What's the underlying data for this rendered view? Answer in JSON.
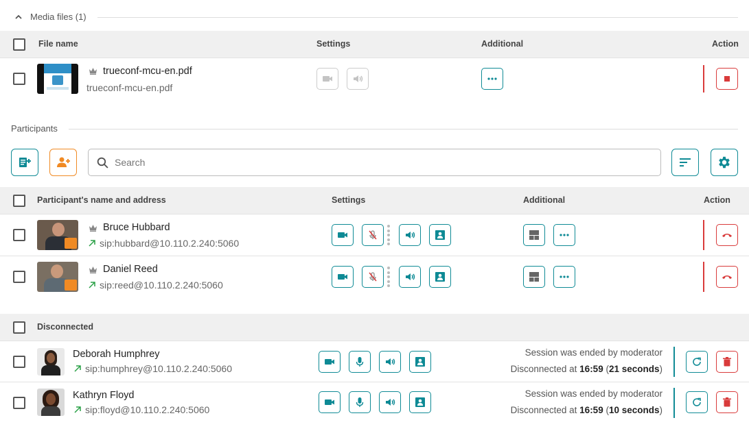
{
  "media": {
    "title": "Media files (1)",
    "headers": {
      "file_name": "File name",
      "settings": "Settings",
      "additional": "Additional",
      "action": "Action"
    },
    "file": {
      "title": "trueconf-mcu-en.pdf",
      "subtitle": "trueconf-mcu-en.pdf"
    }
  },
  "participants": {
    "title": "Participants",
    "search_placeholder": "Search",
    "headers": {
      "name": "Participant's name and address",
      "settings": "Settings",
      "additional": "Additional",
      "action": "Action"
    },
    "rows": [
      {
        "name": "Bruce Hubbard",
        "address": "sip:hubbard@10.110.2.240:5060"
      },
      {
        "name": "Daniel Reed",
        "address": "sip:reed@10.110.2.240:5060"
      }
    ]
  },
  "disconnected": {
    "title": "Disconnected",
    "rows": [
      {
        "name": "Deborah Humphrey",
        "address": "sip:humphrey@10.110.2.240:5060",
        "status": "Session was ended by moderator",
        "disc_prefix": "Disconnected at ",
        "time": "16:59",
        "paren_open": " (",
        "duration": "21 seconds",
        "paren_close": ")"
      },
      {
        "name": "Kathryn Floyd",
        "address": "sip:floyd@10.110.2.240:5060",
        "status": "Session was ended by moderator",
        "disc_prefix": "Disconnected at ",
        "time": "16:59",
        "paren_open": " (",
        "duration": "10 seconds",
        "paren_close": ")"
      }
    ]
  },
  "colors": {
    "accent": "#0e8a95",
    "danger": "#d93b3b",
    "orange": "#f08a24",
    "online": "#2aa147"
  }
}
